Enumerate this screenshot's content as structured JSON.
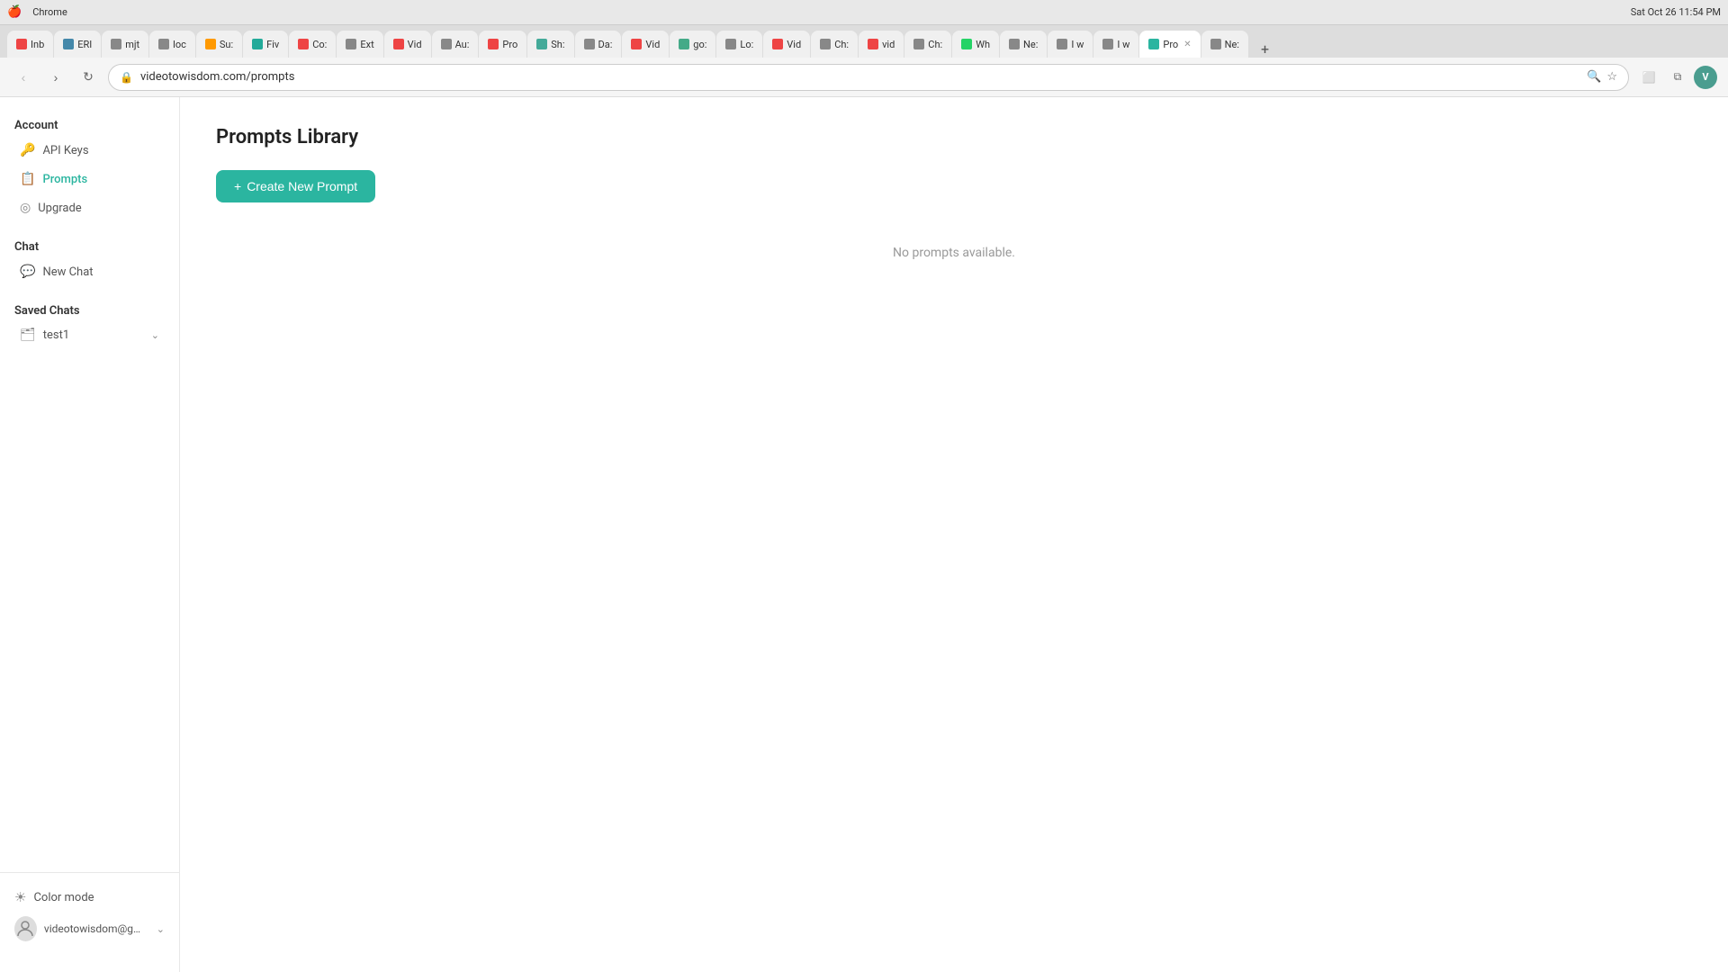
{
  "os": {
    "topbar_time": "Sat Oct 26  11:54 PM",
    "apple_logo": "🍎"
  },
  "browser": {
    "url": "videotowisdom.com/prompts",
    "tabs": [
      {
        "label": "Inb",
        "active": false,
        "favicon": "M"
      },
      {
        "label": "ERI",
        "active": false,
        "favicon": "E"
      },
      {
        "label": "mjt",
        "active": false,
        "favicon": "m"
      },
      {
        "label": "loc",
        "active": false,
        "favicon": "l"
      },
      {
        "label": "Su:",
        "active": false,
        "favicon": "S"
      },
      {
        "label": "Fiv",
        "active": false,
        "favicon": "F"
      },
      {
        "label": "Co:",
        "active": false,
        "favicon": "C"
      },
      {
        "label": "Ext",
        "active": false,
        "favicon": "E"
      },
      {
        "label": "Vid",
        "active": false,
        "favicon": "V"
      },
      {
        "label": "Au:",
        "active": false,
        "favicon": "A"
      },
      {
        "label": "Pro",
        "active": false,
        "favicon": "P"
      },
      {
        "label": "Sh:",
        "active": false,
        "favicon": "S"
      },
      {
        "label": "Da:",
        "active": false,
        "favicon": "D"
      },
      {
        "label": "Vid",
        "active": false,
        "favicon": "V"
      },
      {
        "label": "go:",
        "active": false,
        "favicon": "g"
      },
      {
        "label": "Lo:",
        "active": false,
        "favicon": "L"
      },
      {
        "label": "Vid",
        "active": false,
        "favicon": "V"
      },
      {
        "label": "Ch:",
        "active": false,
        "favicon": "C"
      },
      {
        "label": "vid",
        "active": false,
        "favicon": "v"
      },
      {
        "label": "Ch:",
        "active": false,
        "favicon": "C"
      },
      {
        "label": "Wh",
        "active": false,
        "favicon": "W"
      },
      {
        "label": "Ne:",
        "active": false,
        "favicon": "N"
      },
      {
        "label": "I w",
        "active": false,
        "favicon": "I"
      },
      {
        "label": "I w",
        "active": false,
        "favicon": "I"
      },
      {
        "label": "Pro",
        "active": true,
        "favicon": "P"
      },
      {
        "label": "Ne:",
        "active": false,
        "favicon": "N"
      }
    ],
    "new_tab_label": "+"
  },
  "sidebar": {
    "account_section_label": "Account",
    "items_account": [
      {
        "id": "api-keys",
        "label": "API Keys",
        "icon": "🔑",
        "icon_color": "gray",
        "active": false
      },
      {
        "id": "prompts",
        "label": "Prompts",
        "icon": "📋",
        "icon_color": "red",
        "active": true
      },
      {
        "id": "upgrade",
        "label": "Upgrade",
        "icon": "◎",
        "icon_color": "gray",
        "active": false
      }
    ],
    "chat_section_label": "Chat",
    "items_chat": [
      {
        "id": "new-chat",
        "label": "New Chat",
        "icon": "💬",
        "icon_color": "gray",
        "active": false
      }
    ],
    "saved_chats_section_label": "Saved Chats",
    "saved_chats": [
      {
        "id": "test1",
        "label": "test1"
      }
    ],
    "color_mode_label": "Color mode",
    "color_mode_icon": "☀",
    "user_email": "videotowisdom@gmail..."
  },
  "main": {
    "page_title": "Prompts Library",
    "create_button_label": "Create New Prompt",
    "create_button_icon": "+",
    "empty_message": "No prompts available."
  }
}
